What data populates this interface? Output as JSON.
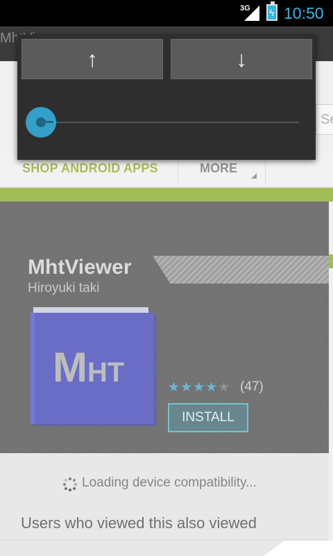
{
  "status_bar": {
    "network": "3G",
    "time": "10:50"
  },
  "app_bar": {
    "title": "MhtViewer"
  },
  "search": {
    "hint": "Se"
  },
  "nav": {
    "shop": "SHOP ANDROID APPS",
    "more": "MORE"
  },
  "app": {
    "name": "MhtViewer",
    "developer": "Hiroyuki taki",
    "icon_text_m": "M",
    "icon_text_ht": "HT",
    "rating": {
      "filled_stars": "★★★★",
      "empty_stars": "★",
      "reviews": "(47)"
    },
    "install_label": "INSTALL"
  },
  "loading": {
    "text": "Loading device compatibility..."
  },
  "section": {
    "also_viewed": "Users who viewed this also viewed"
  },
  "volume_panel": {
    "up_label": "↑",
    "down_label": "↓"
  },
  "colors": {
    "accent": "#33b5e5",
    "brand_green": "#6f9900",
    "install_border": "#2aa3b5"
  }
}
